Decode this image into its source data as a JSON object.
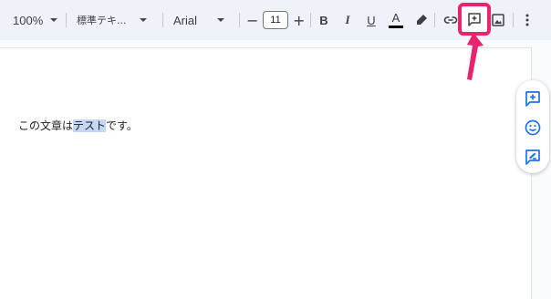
{
  "toolbar": {
    "zoom": "100%",
    "style": "標準テキ...",
    "font": "Arial",
    "font_size": "11",
    "decrease_symbol": "−",
    "increase_symbol": "+",
    "bold": "B",
    "italic": "I",
    "underline": "U",
    "text_color": "A",
    "icons": [
      "link-icon",
      "add-comment-icon",
      "insert-image-icon",
      "more-vert-icon",
      "highlighter-icon"
    ]
  },
  "document": {
    "text_before": "この文章は",
    "text_selected": "テスト",
    "text_after": "です。"
  },
  "side_panel": {
    "icons": [
      "add-comment-icon",
      "emoji-icon",
      "suggest-edit-icon"
    ]
  },
  "colors": {
    "accent": "#e8246e",
    "selection": "#c4d7f5",
    "icon_blue": "#1a73e8",
    "toolbar_bg": "#eef2f9"
  }
}
